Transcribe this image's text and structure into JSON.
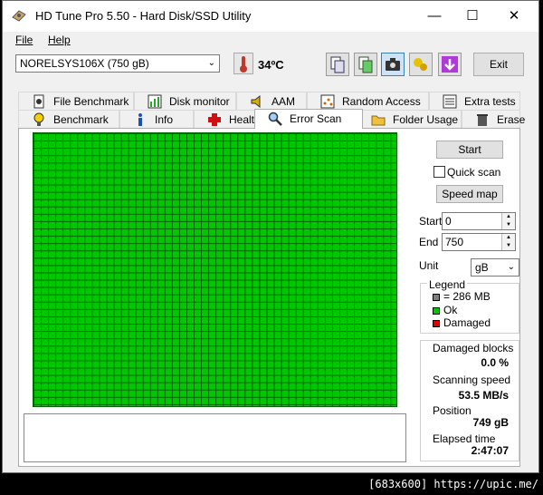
{
  "window": {
    "title": "HD Tune Pro 5.50 - Hard Disk/SSD Utility",
    "minimize": "—",
    "maximize": "☐",
    "close": "✕"
  },
  "menu": {
    "file": "File",
    "help": "Help"
  },
  "toolbar": {
    "drive": "NORELSYS106X (750 gB)",
    "temperature": "34ºC",
    "exit_label": "Exit"
  },
  "tabs": {
    "row1": [
      "File Benchmark",
      "Disk monitor",
      "AAM",
      "Random Access",
      "Extra tests"
    ],
    "row2": [
      "Benchmark",
      "Info",
      "Health",
      "Error Scan",
      "Folder Usage",
      "Erase"
    ],
    "active": "Error Scan"
  },
  "controls": {
    "start_button": "Start",
    "quick_scan": "Quick scan",
    "speed_map": "Speed map",
    "start_label": "Start",
    "start_value": "0",
    "end_label": "End",
    "end_value": "750",
    "unit_label": "Unit",
    "unit_value": "gB"
  },
  "legend": {
    "title": "Legend",
    "block": "= 286 MB",
    "ok": "Ok",
    "damaged": "Damaged"
  },
  "stats": {
    "damaged_blocks_label": "Damaged blocks",
    "damaged_blocks_value": "0.0 %",
    "scanning_speed_label": "Scanning speed",
    "scanning_speed_value": "53.5 MB/s",
    "position_label": "Position",
    "position_value": "749 gB",
    "elapsed_label": "Elapsed time",
    "elapsed_value": "2:47:07"
  },
  "colors": {
    "ok": "#00c800",
    "damaged": "#e00000",
    "block": "#808080",
    "grid_line": "#006400"
  },
  "watermark": "[683x600] https://upic.me/"
}
